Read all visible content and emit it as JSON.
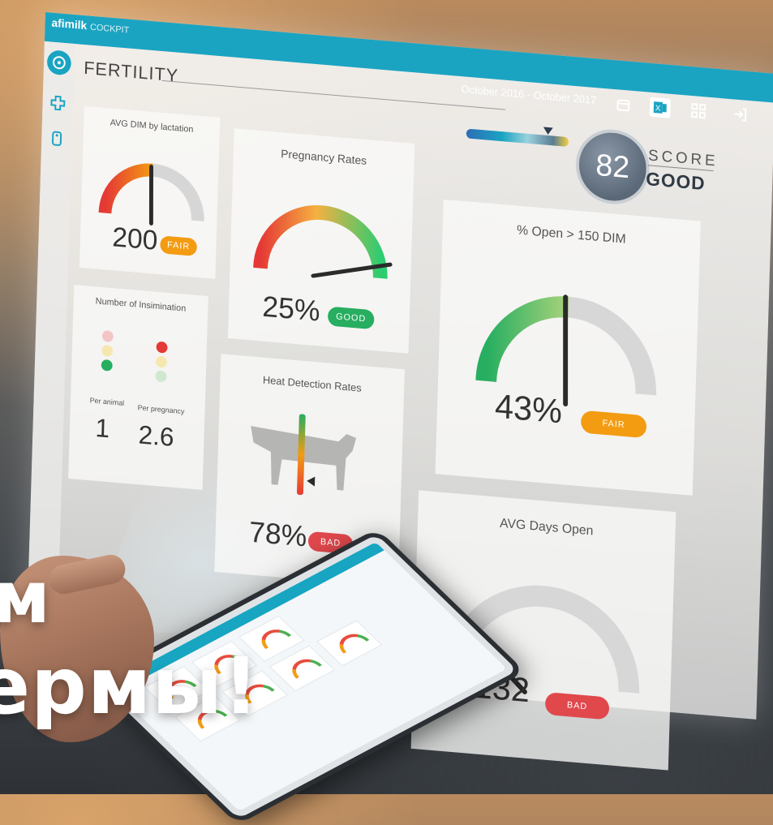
{
  "app": {
    "brand": "afimilk",
    "brand_sub": "COCKPIT"
  },
  "header": {
    "title": "FERTILITY",
    "date_range": "October 2016 - October 2017"
  },
  "score": {
    "value": "82",
    "label": "SCORE",
    "status": "GOOD"
  },
  "toolbar": {
    "icons": [
      "calendar-icon",
      "excel-icon",
      "grid-icon",
      "logout-icon"
    ]
  },
  "sidebar": {
    "icons": [
      "herd-icon",
      "health-cross-icon",
      "tag-icon"
    ]
  },
  "cards": {
    "avg_dim": {
      "title": "AVG DIM by lactation",
      "value": "200",
      "badge": "FAIR"
    },
    "pregnancy": {
      "title": "Pregnancy Rates",
      "value": "25%",
      "badge": "GOOD"
    },
    "open150": {
      "title": "% Open > 150 DIM",
      "value": "43%",
      "badge": "FAIR"
    },
    "insemination": {
      "title": "Number of Insimination",
      "per_animal_label": "Per animal",
      "per_animal_value": "1",
      "per_pregnancy_label": "Per pregnancy",
      "per_pregnancy_value": "2.6"
    },
    "heat": {
      "title": "Heat Detection Rates",
      "value": "78%",
      "badge": "BAD"
    },
    "days_open": {
      "title": "AVG Days Open",
      "value": "132",
      "badge": "BAD"
    }
  },
  "headline": {
    "line1": "м",
    "line2": "ермы!"
  },
  "colors": {
    "accent": "#1aa4c2",
    "good": "#27ae60",
    "fair": "#f39c12",
    "bad": "#e0484c"
  }
}
